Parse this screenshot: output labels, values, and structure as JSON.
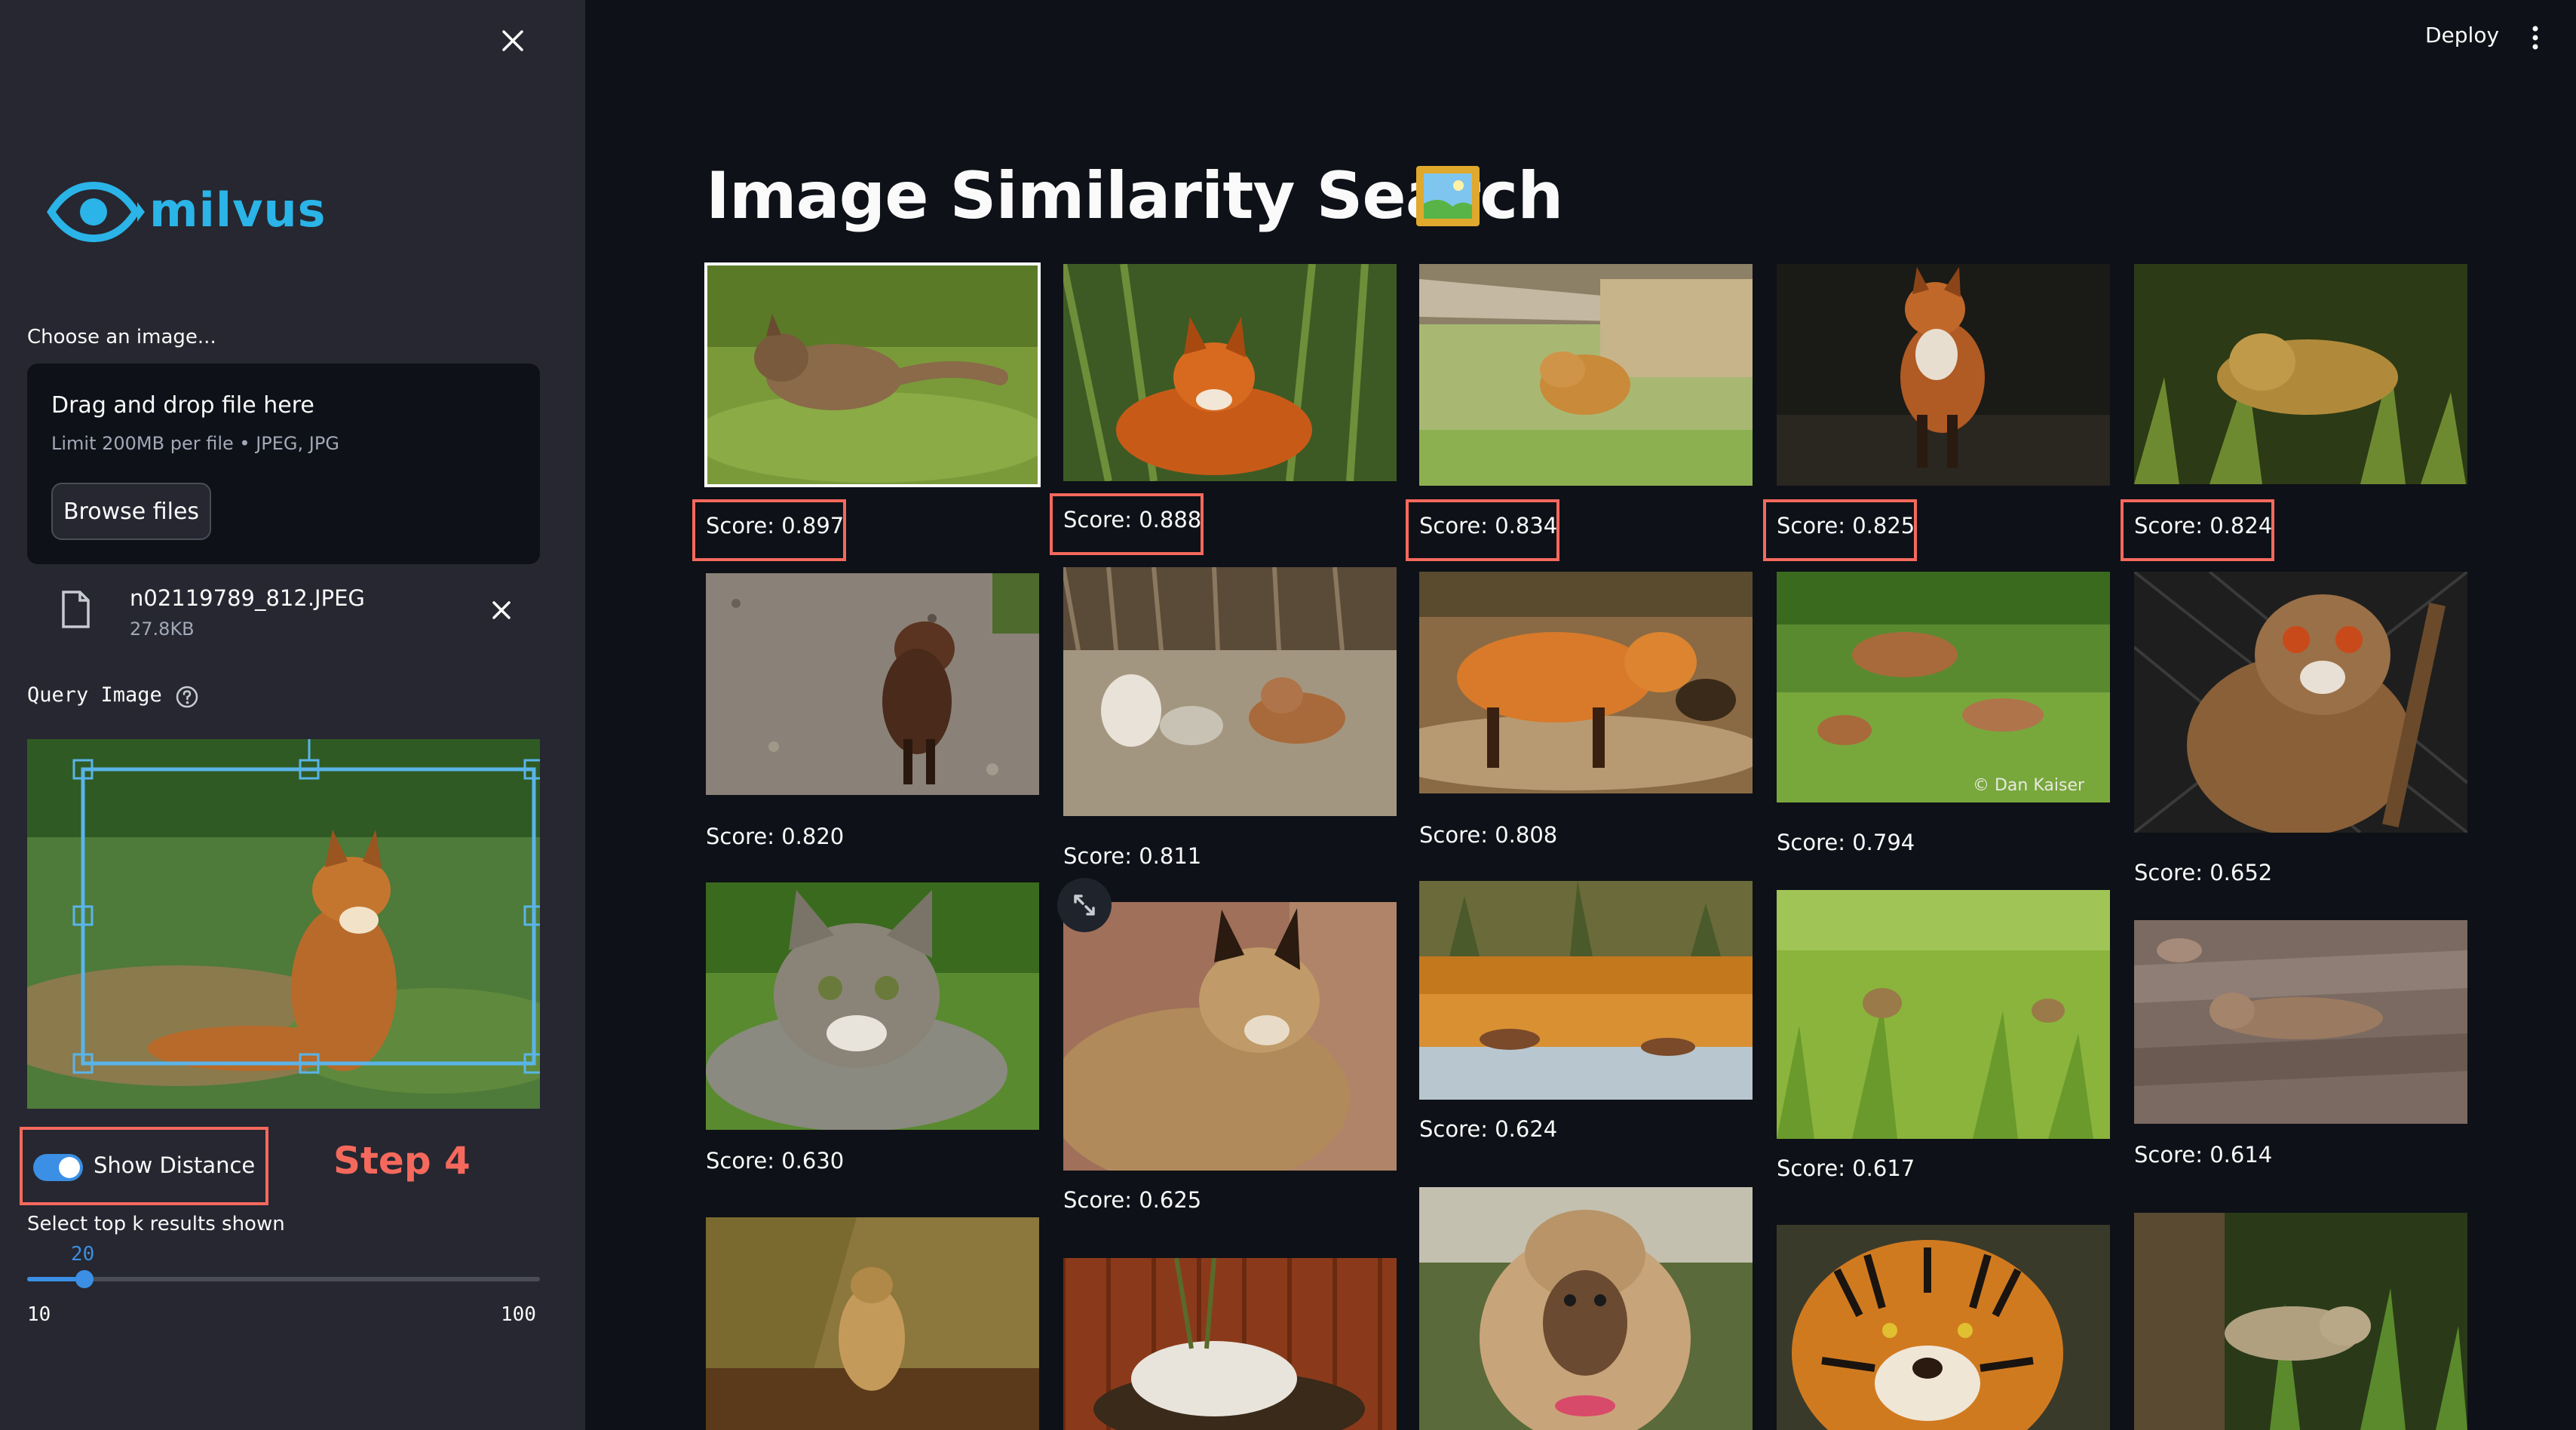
{
  "sidebar": {
    "logo_text": "milvus",
    "choose_label": "Choose an image...",
    "uploader": {
      "title": "Drag and drop file here",
      "limit": "Limit 200MB per file • JPEG, JPG",
      "browse_label": "Browse files"
    },
    "file": {
      "name": "n02119789_812.JPEG",
      "size": "27.8KB"
    },
    "query_label": "Query Image",
    "toggle": {
      "label": "Show Distance",
      "on": true
    },
    "step_annotation": "Step 4",
    "slider": {
      "label": "Select top k results shown",
      "value": "20",
      "min": "10",
      "max": "100"
    }
  },
  "header": {
    "deploy_label": "Deploy"
  },
  "main": {
    "title": "Image Similarity Search",
    "results": [
      {
        "score": "Score: 0.897",
        "subject": "fox-kit"
      },
      {
        "score": "Score: 0.888",
        "subject": "red-fox-grass"
      },
      {
        "score": "Score: 0.834",
        "subject": "fox-resting"
      },
      {
        "score": "Score: 0.825",
        "subject": "fox-night"
      },
      {
        "score": "Score: 0.824",
        "subject": "fox-dark-grass"
      },
      {
        "score": "Score: 0.820",
        "subject": "fox-gravel"
      },
      {
        "score": "Score: 0.811",
        "subject": "fox-family"
      },
      {
        "score": "Score: 0.808",
        "subject": "fox-walking"
      },
      {
        "score": "Score: 0.794",
        "subject": "foxes-grass",
        "watermark": "© Dan Kaiser"
      },
      {
        "score": "Score: 0.652",
        "subject": "lemur"
      },
      {
        "score": "Score: 0.630",
        "subject": "tabby-cat"
      },
      {
        "score": "Score: 0.625",
        "subject": "caracal"
      },
      {
        "score": "Score: 0.624",
        "subject": "capybaras-water"
      },
      {
        "score": "Score: 0.617",
        "subject": "animal-in-grass"
      },
      {
        "score": "Score: 0.614",
        "subject": "mongoose-rocks"
      },
      {
        "score": "",
        "subject": "meerkat"
      },
      {
        "score": "",
        "subject": "dog-in-yard"
      },
      {
        "score": "",
        "subject": "afghan-hound"
      },
      {
        "score": "",
        "subject": "tiger"
      },
      {
        "score": "",
        "subject": "mongoose-forest"
      }
    ]
  },
  "colors": {
    "accent": "#3b8fe4",
    "annotation": "#f5695d",
    "background": "#0e1117",
    "sidebar": "#262730"
  }
}
